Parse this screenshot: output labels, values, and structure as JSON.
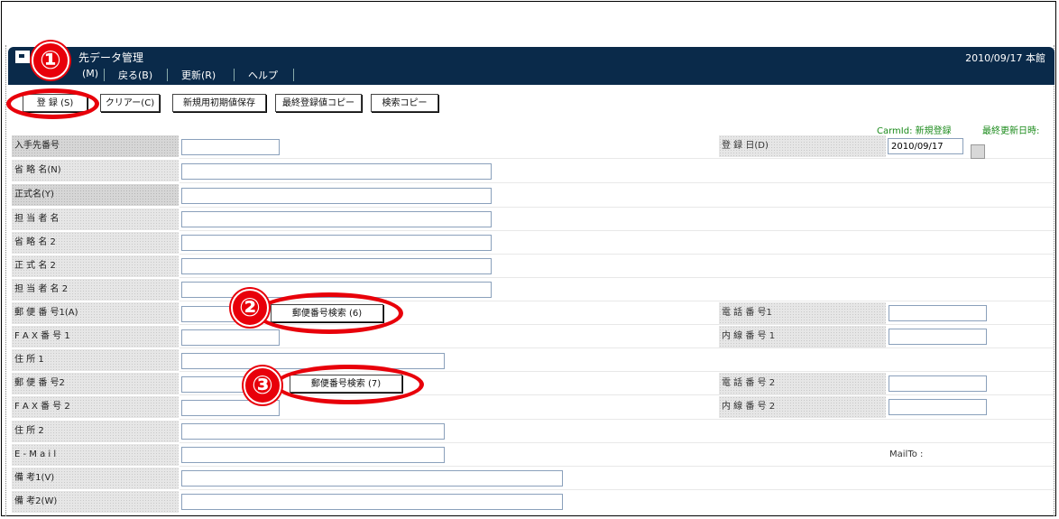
{
  "window": {
    "title": "入手先データ管理",
    "title_partial": "先データ管理",
    "date_location": "2010/09/17 本館"
  },
  "menu": [
    {
      "label": "(M)"
    },
    {
      "label": "戻る(B)"
    },
    {
      "label": "更新(R)"
    },
    {
      "label": "ヘルプ"
    }
  ],
  "toolbar": {
    "register": "登 録 (S)",
    "clear": "クリアー(C)",
    "save_initial": "新規用初期値保存",
    "copy_last": "最終登録値コピー",
    "search_copy": "検索コピー"
  },
  "status": {
    "carm_id": "CarmId: 新規登録",
    "last_updated": "最終更新日時:"
  },
  "form": {
    "supplier_no": "入手先番号",
    "short_name": "省 略 名(N)",
    "formal_name": "正式名(Y)",
    "person": "担 当 者 名",
    "short_name2": "省 略 名 2",
    "formal_name2": "正 式 名 2",
    "person2": "担 当 者 名 2",
    "zip1": "郵 便 番 号1(A)",
    "fax1": "F A X 番 号 1",
    "address1": "住 所 1",
    "zip2": "郵 便 番 号2",
    "fax2": "F A X 番 号 2",
    "address2": "住 所 2",
    "email": "E - M a i l",
    "note1": "備 考1(V)",
    "note2": "備 考2(W)",
    "reg_date_label": "登 録 日(D)",
    "reg_date_value": "2010/09/17",
    "tel1": "電 話 番 号1",
    "ext1": "内 線 番 号 1",
    "tel2": "電 話 番 号 2",
    "ext2": "内 線 番 号 2",
    "mailto": "MailTo :",
    "zip_search1": "郵便番号検索 (6)",
    "zip_search2": "郵便番号検索 (7)"
  },
  "annotations": {
    "one": "①",
    "two": "②",
    "three": "③"
  },
  "colors": {
    "titlebar": "#0a2a4a",
    "annotation_red": "#e8000a",
    "status_green": "#1a8a1a"
  }
}
